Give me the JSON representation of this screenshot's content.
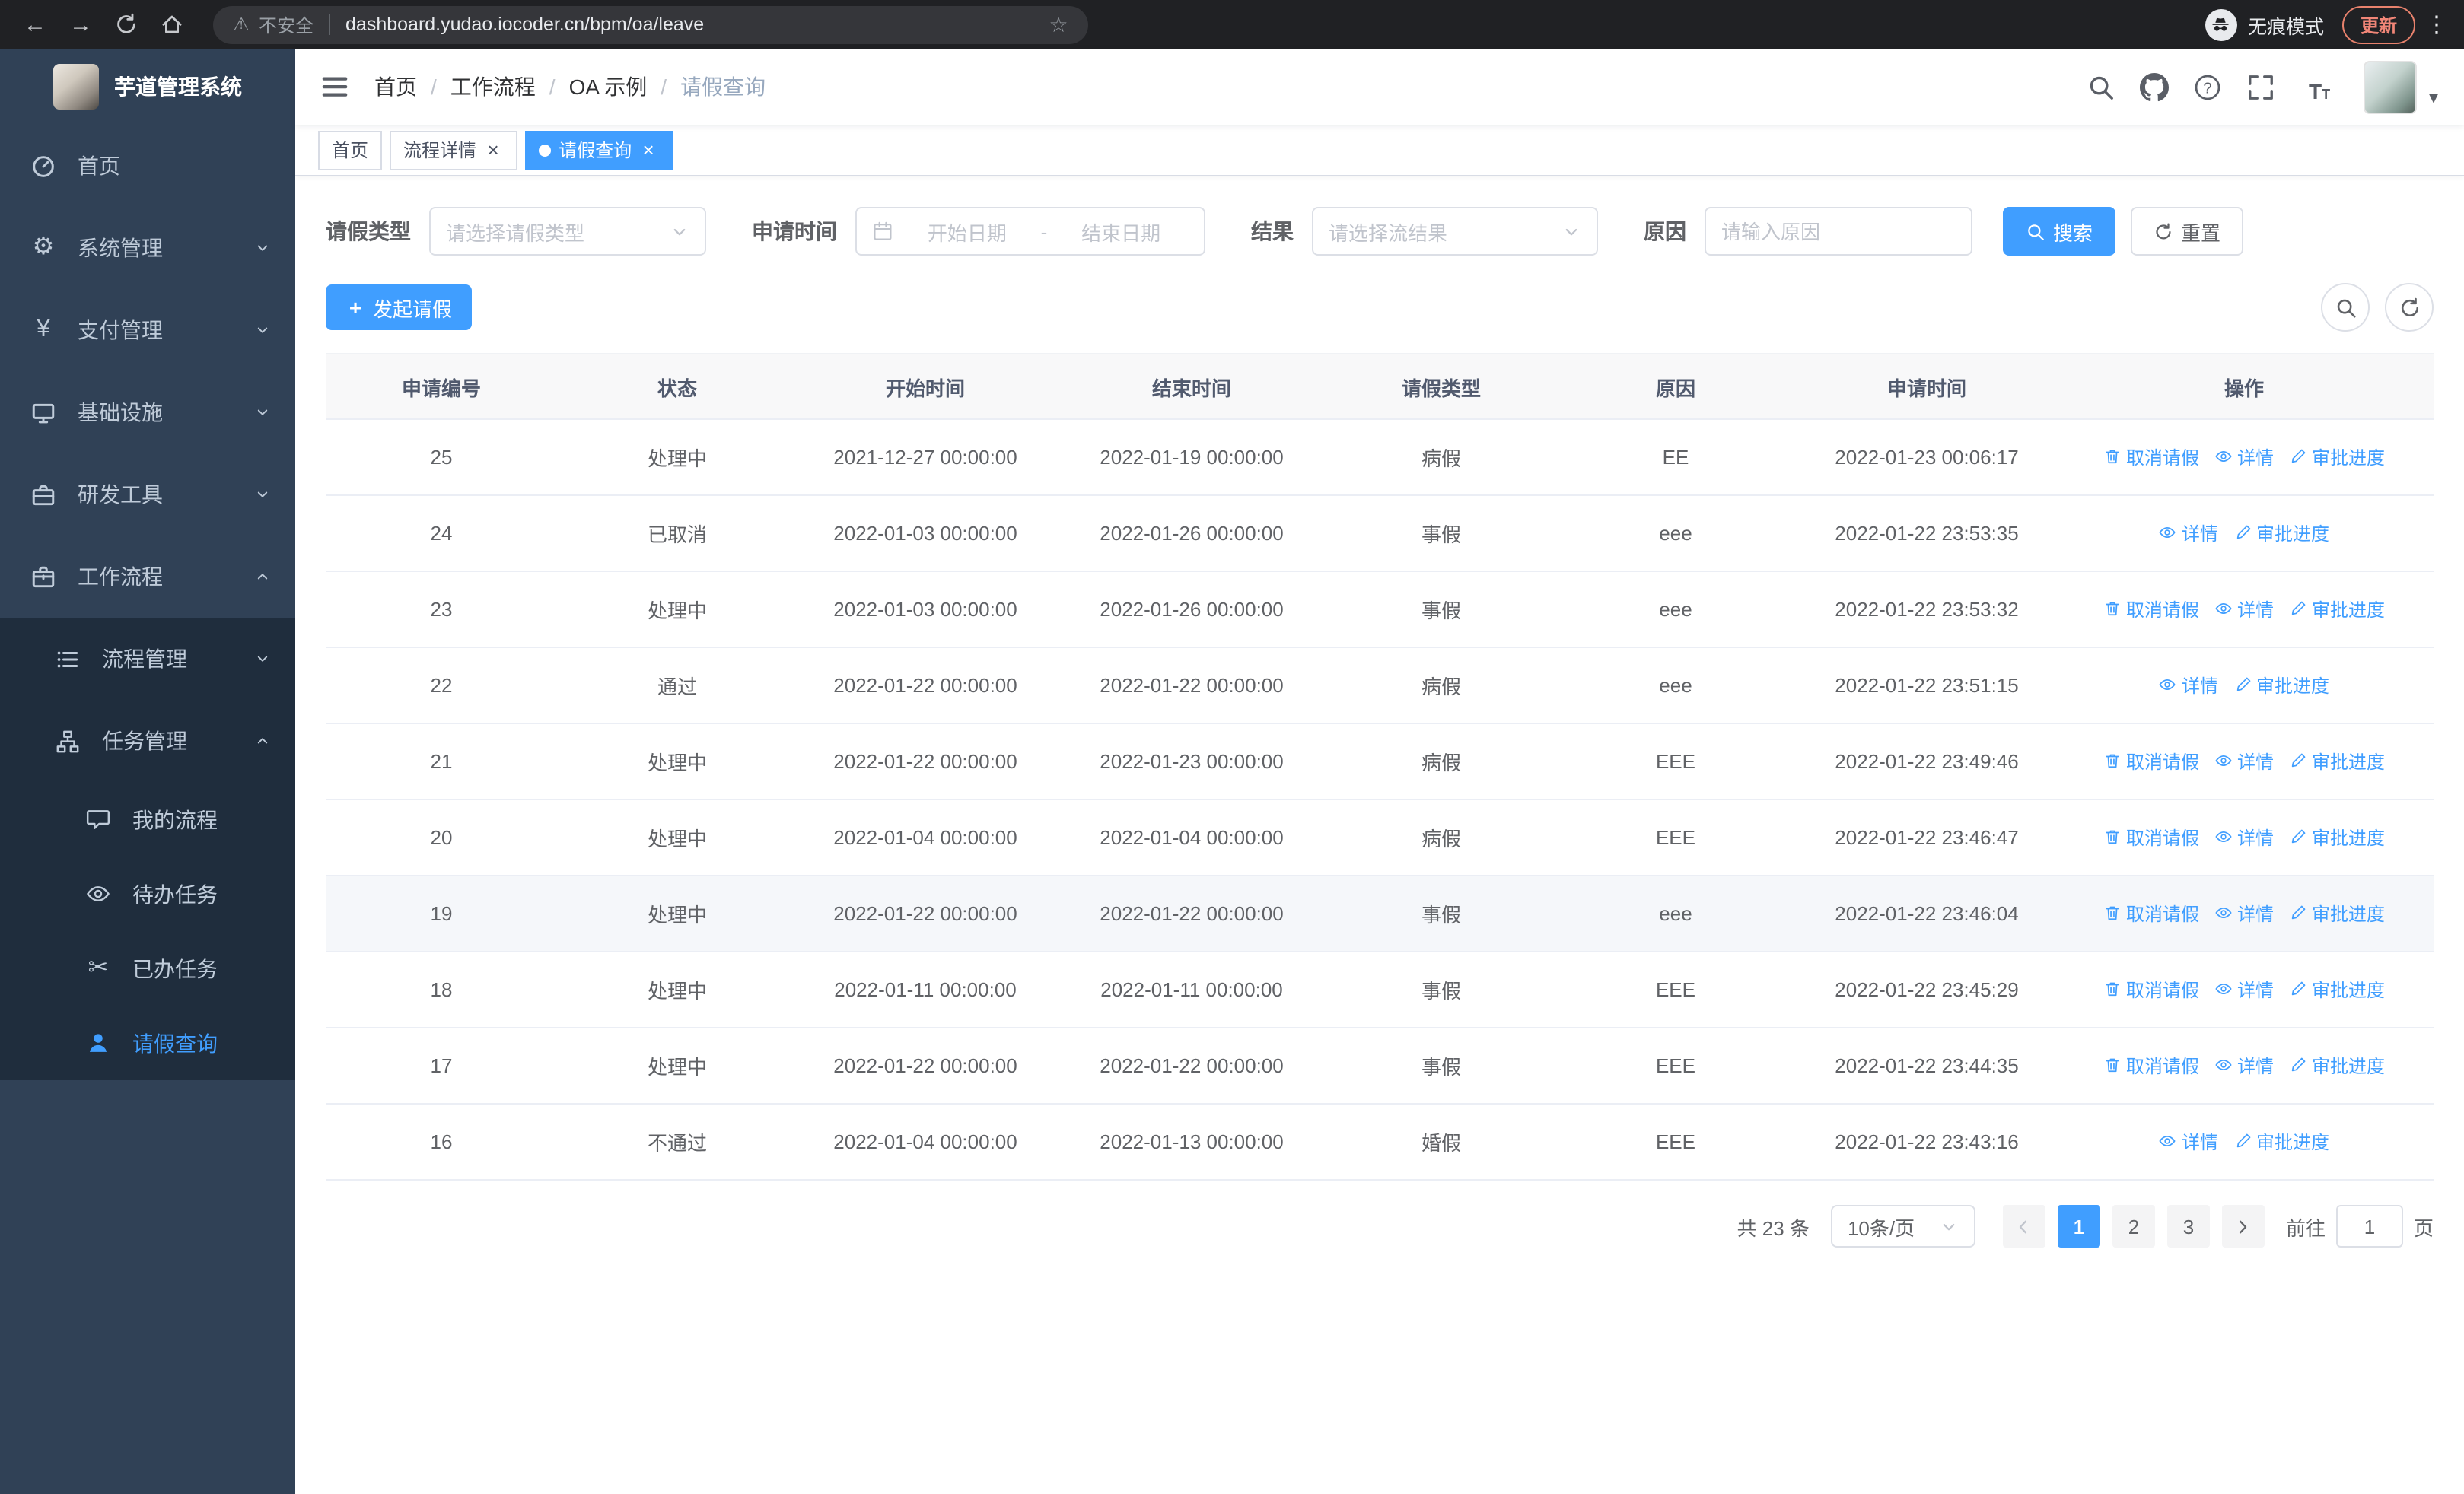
{
  "browser": {
    "security_label": "不安全",
    "url": "dashboard.yudao.iocoder.cn/bpm/oa/leave",
    "incognito_label": "无痕模式",
    "update_label": "更新"
  },
  "sidebar": {
    "logo_title": "芋道管理系统",
    "items": [
      {
        "label": "首页",
        "icon": "dashboard-icon"
      },
      {
        "label": "系统管理",
        "icon": "gear-icon",
        "chevron": "down"
      },
      {
        "label": "支付管理",
        "icon": "yen-icon",
        "chevron": "down"
      },
      {
        "label": "基础设施",
        "icon": "monitor-icon",
        "chevron": "down"
      },
      {
        "label": "研发工具",
        "icon": "toolbox-icon",
        "chevron": "down"
      },
      {
        "label": "工作流程",
        "icon": "briefcase-icon",
        "chevron": "up",
        "expanded": true
      }
    ],
    "workflow_children": [
      {
        "label": "流程管理",
        "icon": "list-icon",
        "chevron": "down"
      },
      {
        "label": "任务管理",
        "icon": "org-icon",
        "chevron": "up",
        "expanded": true
      }
    ],
    "task_children": [
      {
        "label": "我的流程",
        "icon": "chat-icon"
      },
      {
        "label": "待办任务",
        "icon": "eye-icon"
      },
      {
        "label": "已办任务",
        "icon": "scissors-icon"
      },
      {
        "label": "请假查询",
        "icon": "user-icon",
        "active": true
      }
    ]
  },
  "header": {
    "breadcrumbs": [
      "首页",
      "工作流程",
      "OA 示例",
      "请假查询"
    ],
    "breadcrumb_separator": "/"
  },
  "tabs": [
    {
      "label": "首页",
      "closable": false,
      "active": false
    },
    {
      "label": "流程详情",
      "closable": true,
      "active": false
    },
    {
      "label": "请假查询",
      "closable": true,
      "active": true
    }
  ],
  "filters": {
    "leave_type_label": "请假类型",
    "leave_type_placeholder": "请选择请假类型",
    "apply_time_label": "申请时间",
    "start_date_placeholder": "开始日期",
    "date_separator": "-",
    "end_date_placeholder": "结束日期",
    "result_label": "结果",
    "result_placeholder": "请选择流结果",
    "reason_label": "原因",
    "reason_placeholder": "请输入原因",
    "search_button": "搜索",
    "reset_button": "重置"
  },
  "toolbar": {
    "create_label": "发起请假"
  },
  "table": {
    "columns": [
      "申请编号",
      "状态",
      "开始时间",
      "结束时间",
      "请假类型",
      "原因",
      "申请时间",
      "操作"
    ],
    "action_defs": {
      "cancel": {
        "label": "取消请假",
        "icon": "delete-icon"
      },
      "detail": {
        "label": "详情",
        "icon": "view-icon"
      },
      "progress": {
        "label": "审批进度",
        "icon": "edit-icon"
      }
    },
    "rows": [
      {
        "id": "25",
        "status": "处理中",
        "start_time": "2021-12-27 00:00:00",
        "end_time": "2022-01-19 00:00:00",
        "leave_type": "病假",
        "reason": "EE",
        "apply_time": "2022-01-23 00:06:17",
        "actions": [
          "cancel",
          "detail",
          "progress"
        ]
      },
      {
        "id": "24",
        "status": "已取消",
        "start_time": "2022-01-03 00:00:00",
        "end_time": "2022-01-26 00:00:00",
        "leave_type": "事假",
        "reason": "eee",
        "apply_time": "2022-01-22 23:53:35",
        "actions": [
          "detail",
          "progress"
        ]
      },
      {
        "id": "23",
        "status": "处理中",
        "start_time": "2022-01-03 00:00:00",
        "end_time": "2022-01-26 00:00:00",
        "leave_type": "事假",
        "reason": "eee",
        "apply_time": "2022-01-22 23:53:32",
        "actions": [
          "cancel",
          "detail",
          "progress"
        ]
      },
      {
        "id": "22",
        "status": "通过",
        "start_time": "2022-01-22 00:00:00",
        "end_time": "2022-01-22 00:00:00",
        "leave_type": "病假",
        "reason": "eee",
        "apply_time": "2022-01-22 23:51:15",
        "actions": [
          "detail",
          "progress"
        ]
      },
      {
        "id": "21",
        "status": "处理中",
        "start_time": "2022-01-22 00:00:00",
        "end_time": "2022-01-23 00:00:00",
        "leave_type": "病假",
        "reason": "EEE",
        "apply_time": "2022-01-22 23:49:46",
        "actions": [
          "cancel",
          "detail",
          "progress"
        ]
      },
      {
        "id": "20",
        "status": "处理中",
        "start_time": "2022-01-04 00:00:00",
        "end_time": "2022-01-04 00:00:00",
        "leave_type": "病假",
        "reason": "EEE",
        "apply_time": "2022-01-22 23:46:47",
        "actions": [
          "cancel",
          "detail",
          "progress"
        ]
      },
      {
        "id": "19",
        "status": "处理中",
        "start_time": "2022-01-22 00:00:00",
        "end_time": "2022-01-22 00:00:00",
        "leave_type": "事假",
        "reason": "eee",
        "apply_time": "2022-01-22 23:46:04",
        "actions": [
          "cancel",
          "detail",
          "progress"
        ],
        "highlighted": true
      },
      {
        "id": "18",
        "status": "处理中",
        "start_time": "2022-01-11 00:00:00",
        "end_time": "2022-01-11 00:00:00",
        "leave_type": "事假",
        "reason": "EEE",
        "apply_time": "2022-01-22 23:45:29",
        "actions": [
          "cancel",
          "detail",
          "progress"
        ]
      },
      {
        "id": "17",
        "status": "处理中",
        "start_time": "2022-01-22 00:00:00",
        "end_time": "2022-01-22 00:00:00",
        "leave_type": "事假",
        "reason": "EEE",
        "apply_time": "2022-01-22 23:44:35",
        "actions": [
          "cancel",
          "detail",
          "progress"
        ]
      },
      {
        "id": "16",
        "status": "不通过",
        "start_time": "2022-01-04 00:00:00",
        "end_time": "2022-01-13 00:00:00",
        "leave_type": "婚假",
        "reason": "EEE",
        "apply_time": "2022-01-22 23:43:16",
        "actions": [
          "detail",
          "progress"
        ]
      }
    ]
  },
  "pagination": {
    "total_label": "共 23 条",
    "page_size_label": "10条/页",
    "pages": [
      "1",
      "2",
      "3"
    ],
    "active_page": "1",
    "goto_label": "前往",
    "goto_value": "1",
    "goto_unit": "页"
  },
  "colors": {
    "primary": "#409eff",
    "sidebar_bg": "#304156",
    "submenu_bg": "#1f2d3d",
    "update_badge": "#f08577",
    "table_header_bg": "#f8f8f9"
  }
}
